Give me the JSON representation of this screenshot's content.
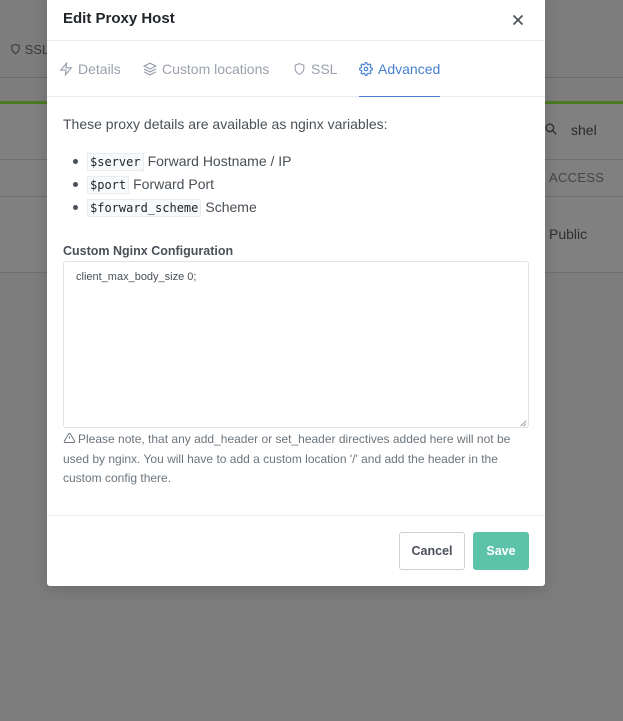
{
  "background": {
    "ssl_label": "SSL",
    "search_value": "shel",
    "column_access": "ACCESS",
    "row_access_value": "Public"
  },
  "modal": {
    "title": "Edit Proxy Host",
    "tabs": [
      {
        "label": "Details",
        "icon": "zap-icon"
      },
      {
        "label": "Custom locations",
        "icon": "layers-icon"
      },
      {
        "label": "SSL",
        "icon": "shield-icon"
      },
      {
        "label": "Advanced",
        "icon": "gear-icon",
        "active": true
      }
    ],
    "intro": "These proxy details are available as nginx variables:",
    "variables": [
      {
        "code": "$server",
        "desc": "Forward Hostname / IP"
      },
      {
        "code": "$port",
        "desc": "Forward Port"
      },
      {
        "code": "$forward_scheme",
        "desc": "Scheme"
      }
    ],
    "config_label": "Custom Nginx Configuration",
    "config_value": "client_max_body_size 0;",
    "note": "Please note, that any add_header or set_header directives added here will not be used by nginx. You will have to add a custom location '/' and add the header in the custom config there.",
    "cancel_label": "Cancel",
    "save_label": "Save"
  },
  "colors": {
    "accent": "#467fcf",
    "save": "#5cc2a8",
    "backdrop": "#7d7d7d"
  }
}
